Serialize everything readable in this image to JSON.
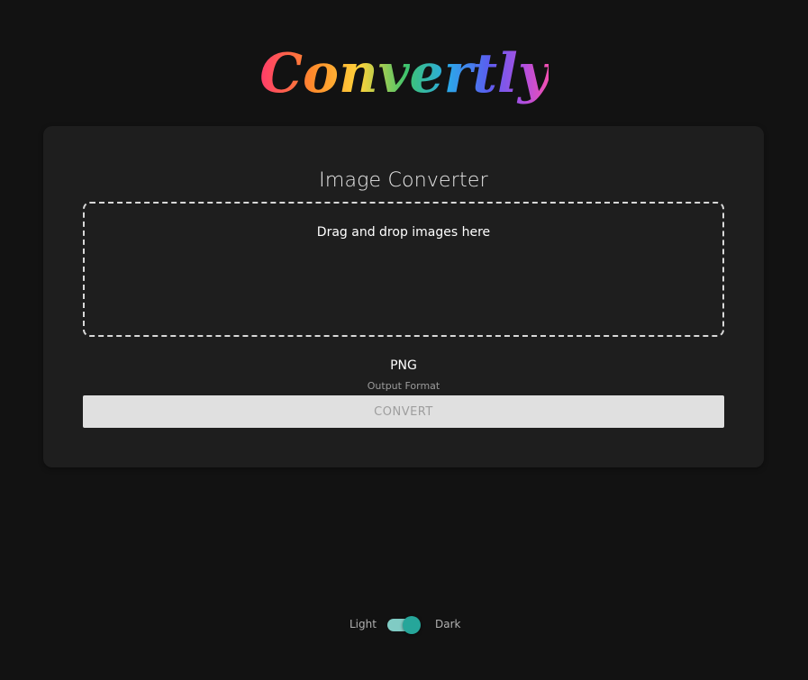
{
  "brand": {
    "logo_text": "Convertly"
  },
  "converter": {
    "title": "Image Converter",
    "dropzone_text": "Drag and drop images here",
    "output_format_value": "PNG",
    "output_format_label": "Output Format",
    "convert_label": "CONVERT"
  },
  "theme": {
    "light_label": "Light",
    "dark_label": "Dark",
    "selected": "Dark"
  },
  "colors": {
    "background": "#121212",
    "card": "#1e1e1e",
    "toggle_track": "#80cbc4",
    "toggle_knob": "#26a69a",
    "button_disabled": "#e0e0e0"
  }
}
